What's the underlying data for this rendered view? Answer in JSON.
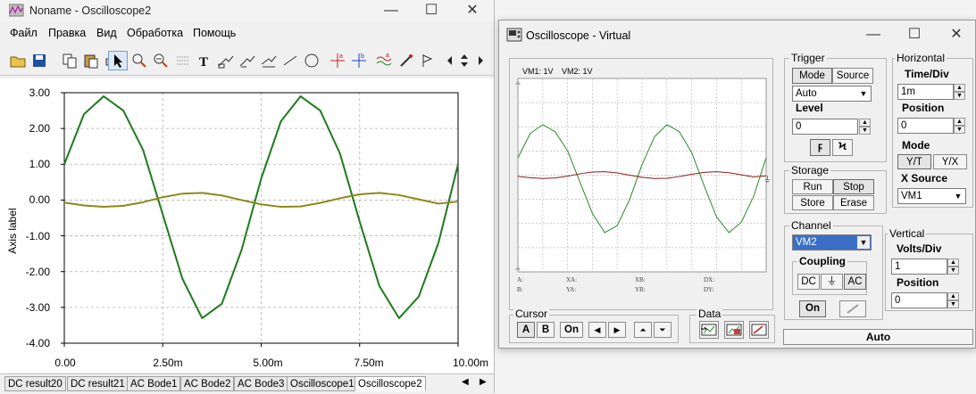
{
  "left_window": {
    "title": "Noname - Oscilloscope2",
    "menu": [
      "Файл",
      "Правка",
      "Вид",
      "Обработка",
      "Помощь"
    ],
    "window_controls": {
      "minimize": "—",
      "maximize": "☐",
      "close": "✕"
    },
    "toolbar_icons": [
      "open-icon",
      "save-icon",
      "copy-icon",
      "paste-icon",
      "print-icon",
      "select-arrow-icon",
      "zoom-in-icon",
      "zoom-out-icon",
      "grid-icon",
      "text-icon",
      "legend-icon",
      "legend2-icon",
      "legend3-icon",
      "line-icon",
      "ellipse-icon",
      "cursor-a-icon",
      "cursor-b-icon",
      "traces-icon",
      "picker-icon",
      "marker-icon",
      "scroll-icon"
    ],
    "tabs": [
      "DC result20",
      "DC result21",
      "AC Bode1",
      "AC Bode2",
      "AC Bode3",
      "Oscilloscope1",
      "Oscilloscope2"
    ],
    "active_tab": "Oscilloscope2"
  },
  "chart_data": {
    "type": "line",
    "title": "",
    "xlabel": "",
    "ylabel": "Axis label",
    "xlim": [
      0,
      10
    ],
    "ylim": [
      -4,
      3
    ],
    "x_ticks": [
      "0.00",
      "2.50m",
      "5.00m",
      "7.50m",
      "10.00m"
    ],
    "y_ticks": [
      "3.00",
      "2.00",
      "1.00",
      "0.00",
      "-1.00",
      "-2.00",
      "-3.00",
      "-4.00"
    ],
    "grid": true,
    "series": [
      {
        "color": "#1e7a1e",
        "x": [
          0,
          0.5,
          1,
          1.5,
          2,
          2.5,
          3,
          3.5,
          4,
          4.5,
          5,
          5.5,
          6,
          6.5,
          7,
          7.5,
          8,
          8.5,
          9,
          9.5,
          10
        ],
        "y": [
          1.0,
          2.4,
          2.9,
          2.5,
          1.4,
          -0.4,
          -2.2,
          -3.3,
          -2.9,
          -1.4,
          0.6,
          2.2,
          2.9,
          2.5,
          1.3,
          -0.6,
          -2.4,
          -3.3,
          -2.7,
          -1.2,
          1.0
        ]
      },
      {
        "color": "#8a8a1a",
        "x": [
          0,
          0.5,
          1,
          1.5,
          2,
          2.5,
          3,
          3.5,
          4,
          4.5,
          5,
          5.5,
          6,
          6.5,
          7,
          7.5,
          8,
          8.5,
          9,
          9.5,
          10
        ],
        "y": [
          -0.07,
          -0.15,
          -0.19,
          -0.16,
          -0.06,
          0.08,
          0.18,
          0.2,
          0.13,
          0.0,
          -0.12,
          -0.19,
          -0.18,
          -0.08,
          0.05,
          0.16,
          0.2,
          0.14,
          0.02,
          -0.1,
          -0.04
        ]
      }
    ]
  },
  "right_window": {
    "title": "Oscilloscope - Virtual",
    "screen": {
      "vm1_label": "VM1: 1V",
      "vm2_label": "VM2: 1V",
      "vm1_color": "#2a8a2a",
      "vm2_color": "#8b1a1a",
      "cursor_labels": [
        "A:",
        "B:",
        "XA:",
        "YA:",
        "XB:",
        "YB:",
        "DX:",
        "DY:"
      ]
    },
    "trigger": {
      "label": "Trigger",
      "mode": "Mode",
      "source": "Source",
      "mode_value": "Auto",
      "level_label": "Level",
      "level_value": "0",
      "edge_rise": "ϝ",
      "edge_fall": "Ϟ"
    },
    "horizontal": {
      "label": "Horizontal",
      "time_div_label": "Time/Div",
      "time_div_value": "1m",
      "position_label": "Position",
      "position_value": "0",
      "mode_label": "Mode",
      "yt": "Y/T",
      "yx": "Y/X",
      "xsource_label": "X Source",
      "xsource_value": "VM1"
    },
    "storage": {
      "label": "Storage",
      "run": "Run",
      "stop": "Stop",
      "store": "Store",
      "erase": "Erase"
    },
    "channel": {
      "label": "Channel",
      "value": "VM2",
      "coupling_label": "Coupling",
      "dc": "DC",
      "gnd": "⏚",
      "ac": "AC",
      "on": "On"
    },
    "vertical": {
      "label": "Vertical",
      "volts_div_label": "Volts/Div",
      "volts_div_value": "1",
      "position_label": "Position",
      "position_value": "0"
    },
    "cursor": {
      "label": "Cursor",
      "a": "A",
      "b": "B",
      "on": "On",
      "left": "◀",
      "right": "▶",
      "up": "⏶",
      "down": "⏷"
    },
    "data": {
      "label": "Data"
    },
    "auto_button": "Auto"
  }
}
